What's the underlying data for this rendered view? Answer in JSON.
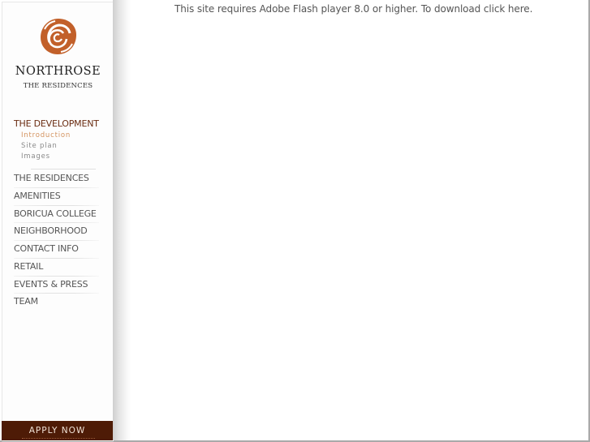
{
  "brand": {
    "name": "NORTHROSE",
    "subtitle": "THE RESIDENCES",
    "logo_icon": "rose-icon",
    "accent_color": "#c2602a"
  },
  "sidebar": {
    "section": {
      "title": "THE DEVELOPMENT",
      "items": [
        {
          "label": "Introduction",
          "active": true
        },
        {
          "label": "Site plan",
          "active": false
        },
        {
          "label": "Images",
          "active": false
        }
      ]
    },
    "nav": [
      {
        "label": "THE RESIDENCES"
      },
      {
        "label": "AMENITIES"
      },
      {
        "label": "BORICUA COLLEGE"
      },
      {
        "label": "NEIGHBORHOOD"
      },
      {
        "label": "CONTACT INFO"
      },
      {
        "label": "RETAIL"
      },
      {
        "label": "EVENTS & PRESS"
      },
      {
        "label": "TEAM"
      }
    ],
    "apply_label": "APPLY NOW",
    "apply_color": "#4e1b06"
  },
  "main": {
    "flash_message": "This site requires Adobe Flash player 8.0 or higher. To download click here."
  }
}
